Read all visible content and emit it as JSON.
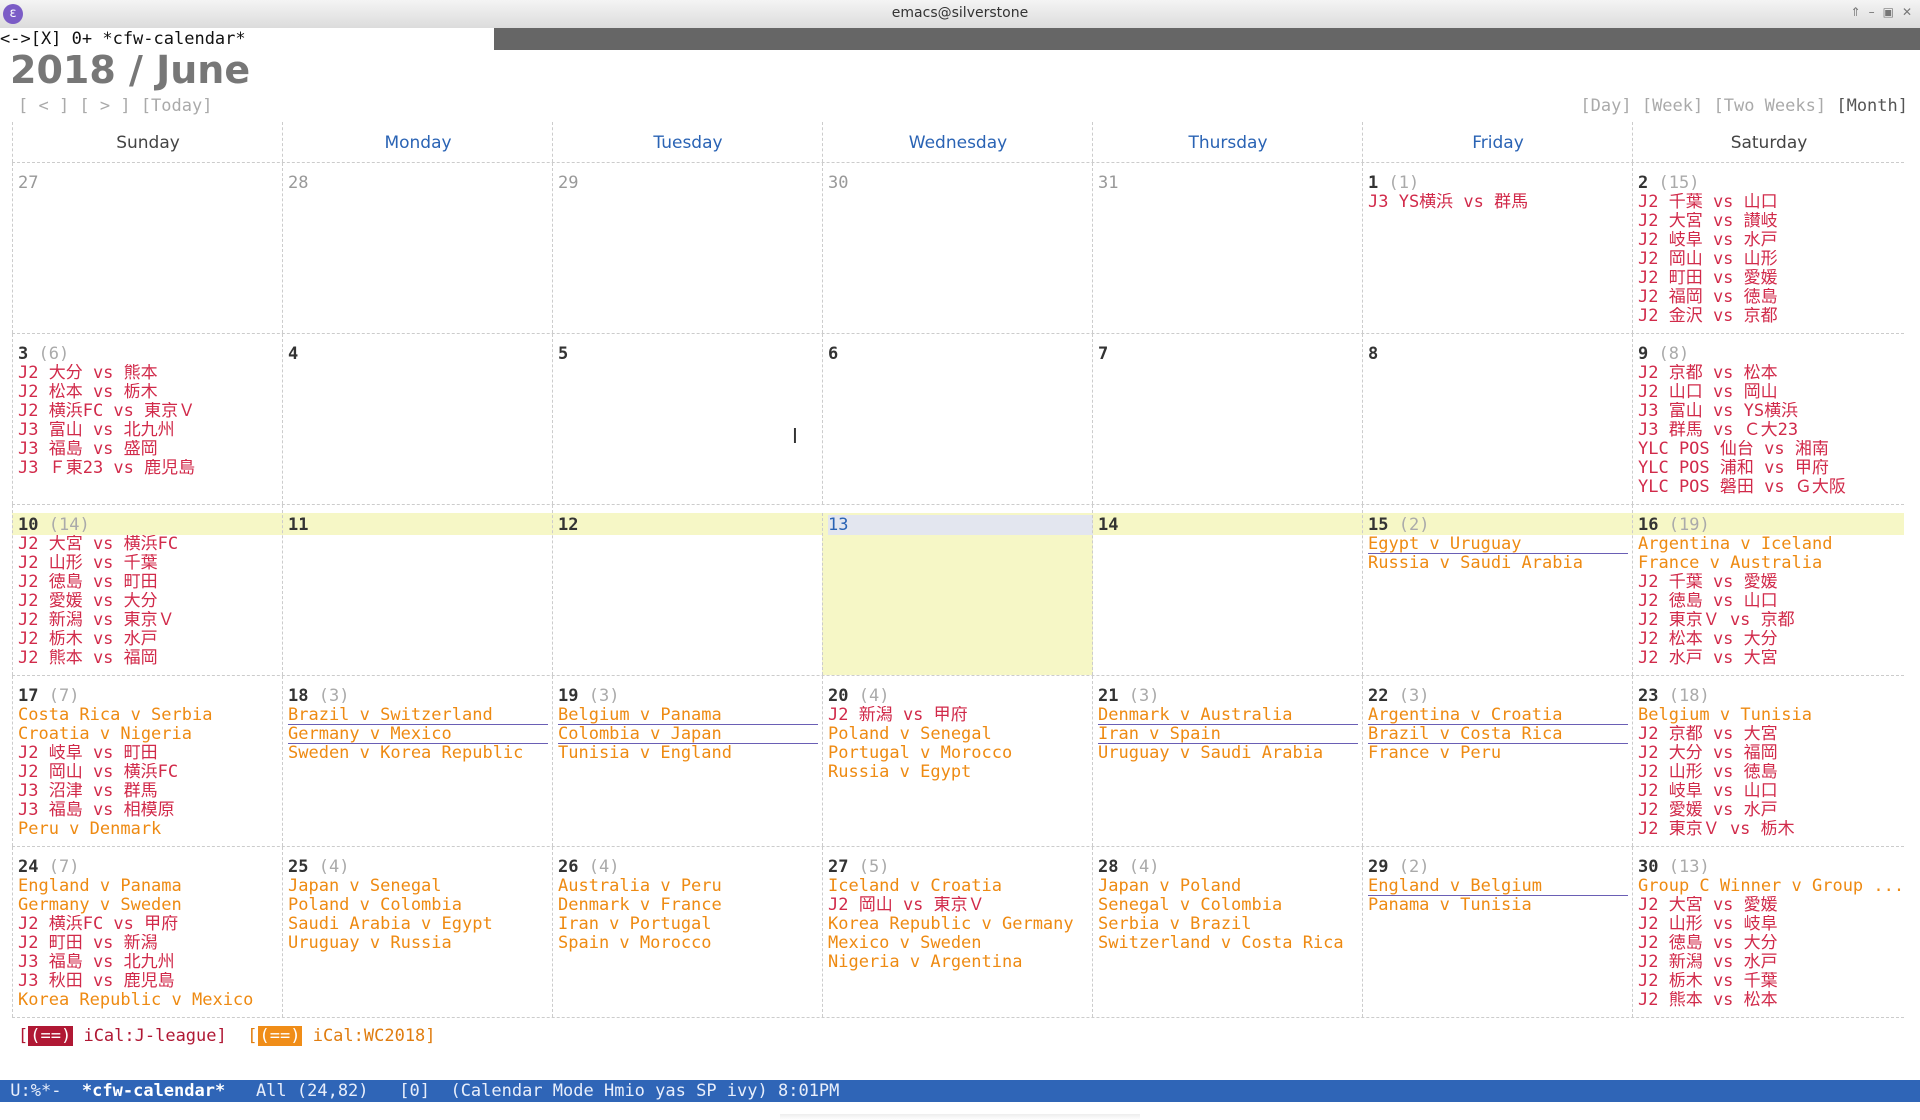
{
  "window": {
    "title": "emacs@silverstone"
  },
  "tabline": {
    "text": "<->[X] 0+ *cfw-calendar*"
  },
  "calendar": {
    "title": "2018 / June",
    "nav_left": "[ < ] [ > ] [Today]",
    "views": [
      "[Day]",
      "[Week]",
      "[Two Weeks]",
      "[Month]"
    ],
    "selected_view": "[Month]"
  },
  "weekdays": [
    "Sunday",
    "Monday",
    "Tuesday",
    "Wednesday",
    "Thursday",
    "Friday",
    "Saturday"
  ],
  "weeks": [
    {
      "days": [
        {
          "num": "27",
          "other": true,
          "events": []
        },
        {
          "num": "28",
          "other": true,
          "events": []
        },
        {
          "num": "29",
          "other": true,
          "events": []
        },
        {
          "num": "30",
          "other": true,
          "events": []
        },
        {
          "num": "31",
          "other": true,
          "events": []
        },
        {
          "num": "1",
          "count": "(1)",
          "events": [
            {
              "t": "J3 YS横浜 vs 群馬",
              "c": "j"
            }
          ]
        },
        {
          "num": "2",
          "count": "(15)",
          "events": [
            {
              "t": "J2 千葉 vs 山口",
              "c": "j"
            },
            {
              "t": "J2 大宮 vs 讃岐",
              "c": "j"
            },
            {
              "t": "J2 岐阜 vs 水戸",
              "c": "j"
            },
            {
              "t": "J2 岡山 vs 山形",
              "c": "j"
            },
            {
              "t": "J2 町田 vs 愛媛",
              "c": "j"
            },
            {
              "t": "J2 福岡 vs 徳島",
              "c": "j"
            },
            {
              "t": "J2 金沢 vs 京都",
              "c": "j"
            }
          ]
        }
      ]
    },
    {
      "days": [
        {
          "num": "3",
          "count": "(6)",
          "events": [
            {
              "t": "J2 大分 vs 熊本",
              "c": "j"
            },
            {
              "t": "J2 松本 vs 栃木",
              "c": "j"
            },
            {
              "t": "J2 横浜FC vs 東京Ｖ",
              "c": "j"
            },
            {
              "t": "J3 富山 vs 北九州",
              "c": "j"
            },
            {
              "t": "J3 福島 vs 盛岡",
              "c": "j"
            },
            {
              "t": "J3 Ｆ東23 vs 鹿児島",
              "c": "j"
            }
          ]
        },
        {
          "num": "4",
          "events": []
        },
        {
          "num": "5",
          "events": []
        },
        {
          "num": "6",
          "events": []
        },
        {
          "num": "7",
          "events": []
        },
        {
          "num": "8",
          "events": []
        },
        {
          "num": "9",
          "count": "(8)",
          "events": [
            {
              "t": "J2 京都 vs 松本",
              "c": "j"
            },
            {
              "t": "J2 山口 vs 岡山",
              "c": "j"
            },
            {
              "t": "J3 富山 vs YS横浜",
              "c": "j"
            },
            {
              "t": "J3 群馬 vs Ｃ大23",
              "c": "j"
            },
            {
              "t": "YLC POS 仙台 vs 湘南",
              "c": "j"
            },
            {
              "t": "YLC POS 浦和 vs 甲府",
              "c": "j"
            },
            {
              "t": "YLC POS 磐田 vs Ｇ大阪",
              "c": "j"
            }
          ]
        }
      ]
    },
    {
      "today_week": true,
      "days": [
        {
          "num": "10",
          "count": "(14)",
          "events": [
            {
              "t": "J2 大宮 vs 横浜FC",
              "c": "j"
            },
            {
              "t": "J2 山形 vs 千葉",
              "c": "j"
            },
            {
              "t": "J2 徳島 vs 町田",
              "c": "j"
            },
            {
              "t": "J2 愛媛 vs 大分",
              "c": "j"
            },
            {
              "t": "J2 新潟 vs 東京Ｖ",
              "c": "j"
            },
            {
              "t": "J2 栃木 vs 水戸",
              "c": "j"
            },
            {
              "t": "J2 熊本 vs 福岡",
              "c": "j"
            }
          ]
        },
        {
          "num": "11",
          "events": []
        },
        {
          "num": "12",
          "events": []
        },
        {
          "num": "13",
          "today": true,
          "events": []
        },
        {
          "num": "14",
          "events": []
        },
        {
          "num": "15",
          "count": "(2)",
          "events": [
            {
              "t": "Egypt v Uruguay",
              "c": "w",
              "u": true
            },
            {
              "t": "Russia v Saudi Arabia",
              "c": "w"
            }
          ]
        },
        {
          "num": "16",
          "count": "(19)",
          "events": [
            {
              "t": "Argentina v Iceland",
              "c": "w"
            },
            {
              "t": "France v Australia",
              "c": "w"
            },
            {
              "t": "J2 千葉 vs 愛媛",
              "c": "j"
            },
            {
              "t": "J2 徳島 vs 山口",
              "c": "j"
            },
            {
              "t": "J2 東京Ｖ vs 京都",
              "c": "j"
            },
            {
              "t": "J2 松本 vs 大分",
              "c": "j"
            },
            {
              "t": "J2 水戸 vs 大宮",
              "c": "j"
            }
          ]
        }
      ]
    },
    {
      "days": [
        {
          "num": "17",
          "count": "(7)",
          "events": [
            {
              "t": "Costa Rica v Serbia",
              "c": "w"
            },
            {
              "t": "Croatia v Nigeria",
              "c": "w"
            },
            {
              "t": "J2 岐阜 vs 町田",
              "c": "j"
            },
            {
              "t": "J2 岡山 vs 横浜FC",
              "c": "j"
            },
            {
              "t": "J3 沼津 vs 群馬",
              "c": "j"
            },
            {
              "t": "J3 福島 vs 相模原",
              "c": "j"
            },
            {
              "t": "Peru v Denmark",
              "c": "w"
            }
          ]
        },
        {
          "num": "18",
          "count": "(3)",
          "events": [
            {
              "t": "Brazil v Switzerland",
              "c": "w",
              "u": true
            },
            {
              "t": "Germany v Mexico",
              "c": "w",
              "u": true
            },
            {
              "t": "Sweden v Korea Republic",
              "c": "w"
            }
          ]
        },
        {
          "num": "19",
          "count": "(3)",
          "events": [
            {
              "t": "Belgium v Panama",
              "c": "w",
              "u": true
            },
            {
              "t": "Colombia v Japan",
              "c": "w",
              "u": true
            },
            {
              "t": "Tunisia v England",
              "c": "w"
            }
          ]
        },
        {
          "num": "20",
          "count": "(4)",
          "events": [
            {
              "t": "J2 新潟 vs 甲府",
              "c": "j"
            },
            {
              "t": "Poland v Senegal",
              "c": "w"
            },
            {
              "t": "Portugal v Morocco",
              "c": "w"
            },
            {
              "t": "Russia v Egypt",
              "c": "w"
            }
          ]
        },
        {
          "num": "21",
          "count": "(3)",
          "events": [
            {
              "t": "Denmark v Australia",
              "c": "w",
              "u": true
            },
            {
              "t": "Iran v Spain",
              "c": "w",
              "u": true
            },
            {
              "t": "Uruguay v Saudi Arabia",
              "c": "w"
            }
          ]
        },
        {
          "num": "22",
          "count": "(3)",
          "events": [
            {
              "t": "Argentina v Croatia",
              "c": "w",
              "u": true
            },
            {
              "t": "Brazil v Costa Rica",
              "c": "w",
              "u": true
            },
            {
              "t": "France v Peru",
              "c": "w"
            }
          ]
        },
        {
          "num": "23",
          "count": "(18)",
          "events": [
            {
              "t": "Belgium v Tunisia",
              "c": "w"
            },
            {
              "t": "J2 京都 vs 大宮",
              "c": "j"
            },
            {
              "t": "J2 大分 vs 福岡",
              "c": "j"
            },
            {
              "t": "J2 山形 vs 徳島",
              "c": "j"
            },
            {
              "t": "J2 岐阜 vs 山口",
              "c": "j"
            },
            {
              "t": "J2 愛媛 vs 水戸",
              "c": "j"
            },
            {
              "t": "J2 東京Ｖ vs 栃木",
              "c": "j"
            }
          ]
        }
      ]
    },
    {
      "days": [
        {
          "num": "24",
          "count": "(7)",
          "events": [
            {
              "t": "England v Panama",
              "c": "w"
            },
            {
              "t": "Germany v Sweden",
              "c": "w"
            },
            {
              "t": "J2 横浜FC vs 甲府",
              "c": "j"
            },
            {
              "t": "J2 町田 vs 新潟",
              "c": "j"
            },
            {
              "t": "J3 福島 vs 北九州",
              "c": "j"
            },
            {
              "t": "J3 秋田 vs 鹿児島",
              "c": "j"
            },
            {
              "t": "Korea Republic v Mexico",
              "c": "w"
            }
          ]
        },
        {
          "num": "25",
          "count": "(4)",
          "events": [
            {
              "t": "Japan v Senegal",
              "c": "w"
            },
            {
              "t": "Poland v Colombia",
              "c": "w"
            },
            {
              "t": "Saudi Arabia v Egypt",
              "c": "w"
            },
            {
              "t": "Uruguay v Russia",
              "c": "w"
            }
          ]
        },
        {
          "num": "26",
          "count": "(4)",
          "events": [
            {
              "t": "Australia v Peru",
              "c": "w"
            },
            {
              "t": "Denmark v France",
              "c": "w"
            },
            {
              "t": "Iran v Portugal",
              "c": "w"
            },
            {
              "t": "Spain v Morocco",
              "c": "w"
            }
          ]
        },
        {
          "num": "27",
          "count": "(5)",
          "events": [
            {
              "t": "Iceland v Croatia",
              "c": "w"
            },
            {
              "t": "J2 岡山 vs 東京Ｖ",
              "c": "j"
            },
            {
              "t": "Korea Republic v Germany",
              "c": "w"
            },
            {
              "t": "Mexico v Sweden",
              "c": "w"
            },
            {
              "t": "Nigeria v Argentina",
              "c": "w"
            }
          ]
        },
        {
          "num": "28",
          "count": "(4)",
          "events": [
            {
              "t": "Japan v Poland",
              "c": "w"
            },
            {
              "t": "Senegal v Colombia",
              "c": "w"
            },
            {
              "t": "Serbia v Brazil",
              "c": "w"
            },
            {
              "t": "Switzerland v Costa Rica",
              "c": "w"
            }
          ]
        },
        {
          "num": "29",
          "count": "(2)",
          "events": [
            {
              "t": "England v Belgium",
              "c": "w",
              "u": true
            },
            {
              "t": "Panama v Tunisia",
              "c": "w"
            }
          ]
        },
        {
          "num": "30",
          "count": "(13)",
          "events": [
            {
              "t": "Group C Winner v Group ...",
              "c": "w"
            },
            {
              "t": "J2 大宮 vs 愛媛",
              "c": "j"
            },
            {
              "t": "J2 山形 vs 岐阜",
              "c": "j"
            },
            {
              "t": "J2 徳島 vs 大分",
              "c": "j"
            },
            {
              "t": "J2 新潟 vs 水戸",
              "c": "j"
            },
            {
              "t": "J2 栃木 vs 千葉",
              "c": "j"
            },
            {
              "t": "J2 熊本 vs 松本",
              "c": "j"
            }
          ]
        }
      ]
    }
  ],
  "legend": {
    "j_box": "(==)",
    "j_label": "iCal:J-league",
    "w_box": "(==)",
    "w_label": "iCal:WC2018"
  },
  "modeline": {
    "status": "U:%*-",
    "buffer": "*cfw-calendar*",
    "position": "All (24,82)",
    "count": "[0]",
    "modes": "(Calendar Mode Hmio yas SP ivy)",
    "time": "8:01PM"
  },
  "colors": {
    "jleague": "#d12a4a",
    "wc2018": "#ee8a12",
    "weekday_header": "#2a63b4",
    "modeline": "#2f65b7",
    "today": "#f6f7c6"
  }
}
